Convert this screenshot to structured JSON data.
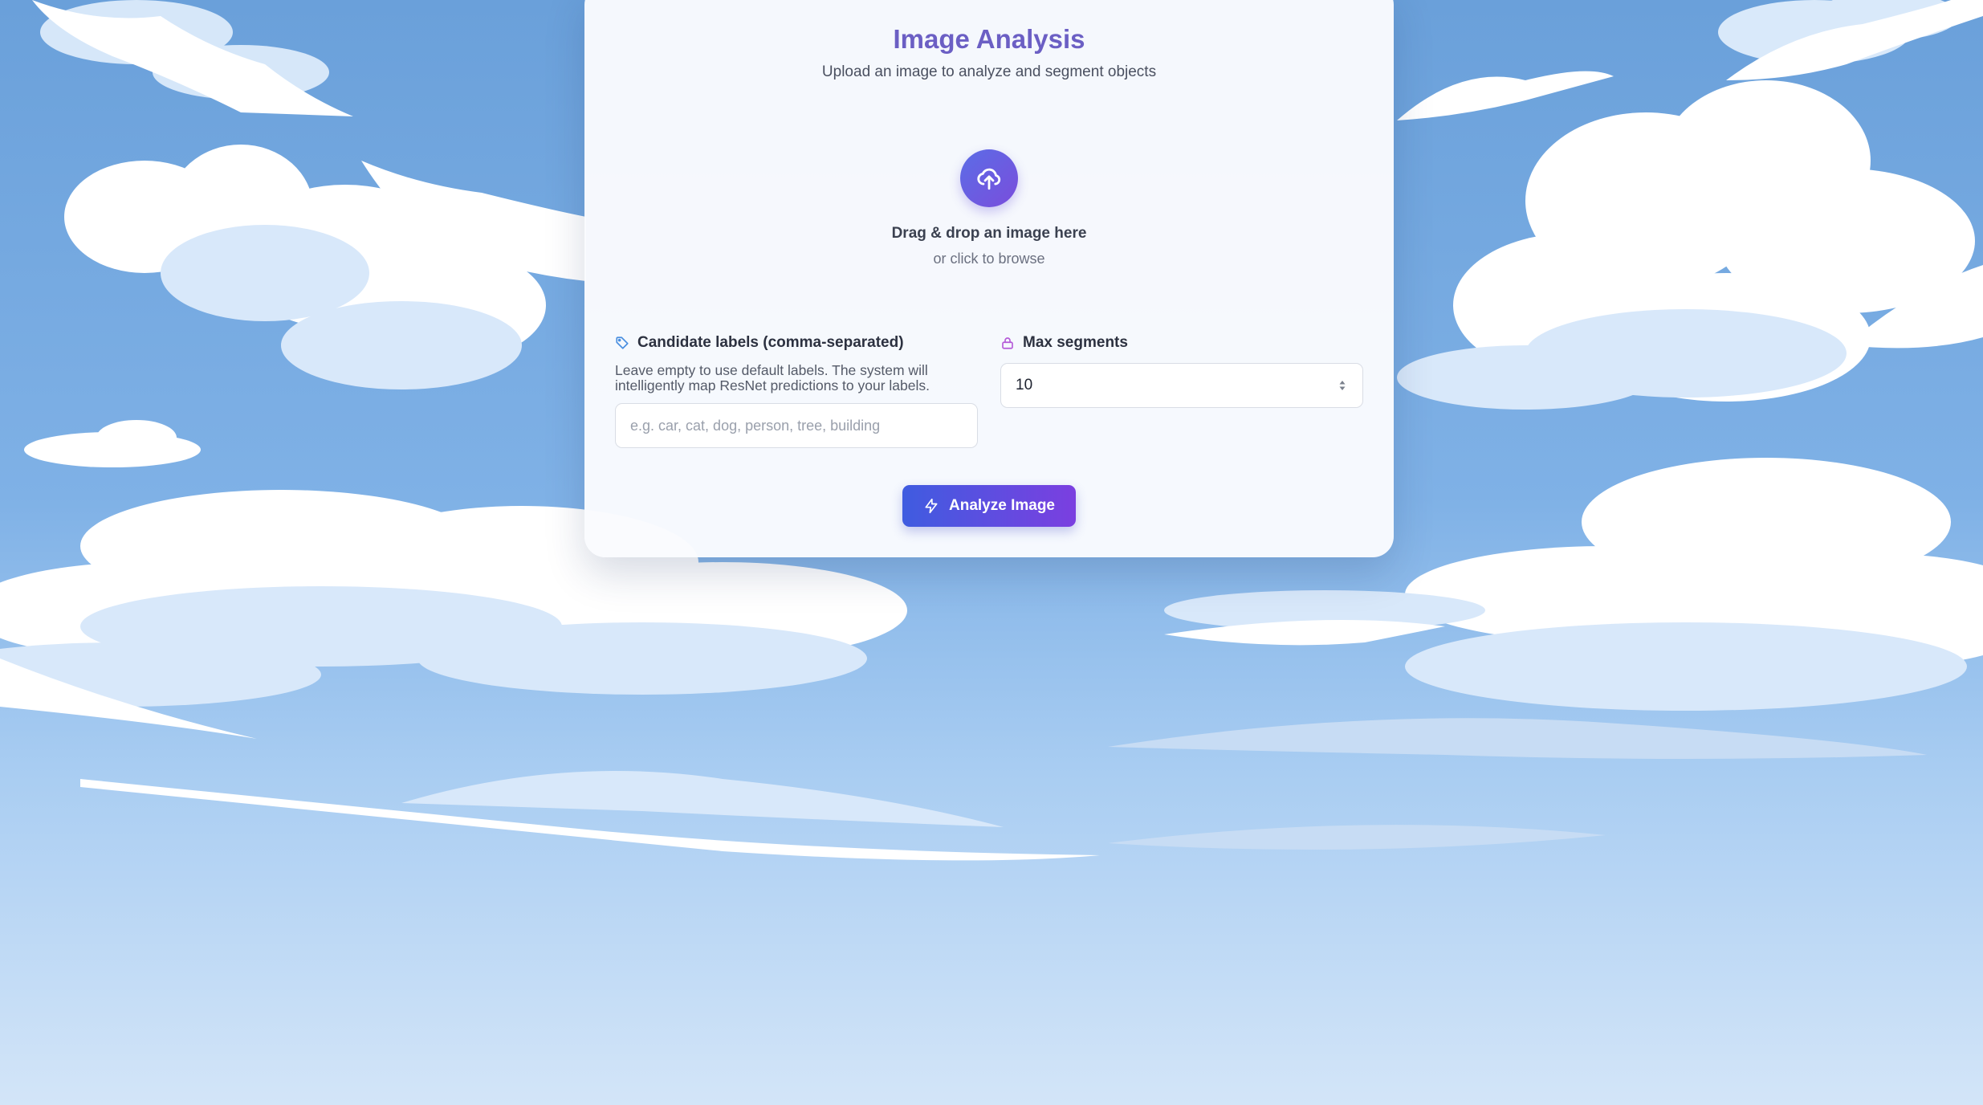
{
  "page": {
    "title": "Image Analysis",
    "subtitle": "Upload an image to analyze and segment objects"
  },
  "upload": {
    "icon": "cloud-upload-icon",
    "title": "Drag & drop an image here",
    "subtitle": "or click to browse"
  },
  "labels_field": {
    "icon": "tag-icon",
    "label": "Candidate labels (comma-separated)",
    "help": "Leave empty to use default labels. The system will intelligently map ResNet predictions to your labels.",
    "value": "",
    "placeholder": "e.g. car, cat, dog, person, tree, building"
  },
  "max_segments_field": {
    "icon": "lock-icon",
    "label": "Max segments",
    "value": "10"
  },
  "analyze_button": {
    "icon": "lightning-icon",
    "label": "Analyze Image"
  },
  "colors": {
    "title": "#6b5fc4",
    "accent_start": "#3f5ce0",
    "accent_end": "#7b3fe0",
    "sky": "#6fa4dc"
  }
}
